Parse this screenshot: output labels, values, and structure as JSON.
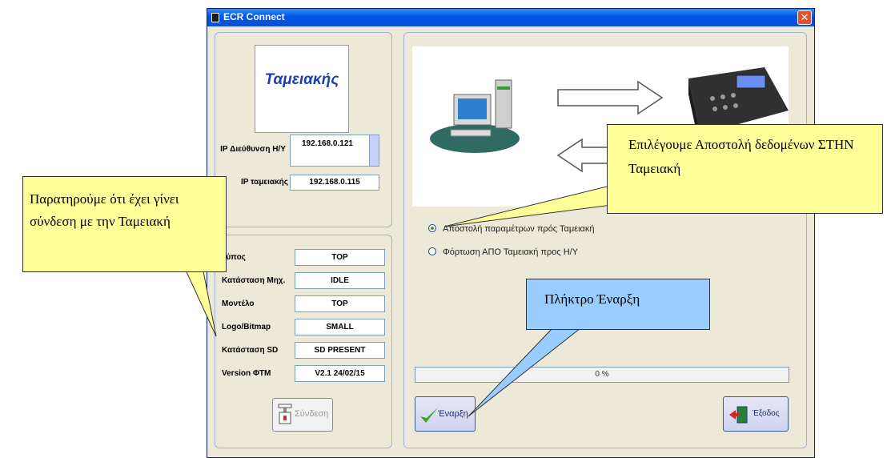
{
  "window": {
    "title": "ECR Connect",
    "close_glyph": "✕"
  },
  "left": {
    "logo_text": "Ταμειακής",
    "ip_pc_label": "IP Διεύθυνση Η/Υ",
    "ip_pc_value": "192.168.0.121",
    "ip_cash_label": "IP ταμειακής",
    "ip_cash_value": "192.168.0.115",
    "info_rows": [
      {
        "label": "Τύπος",
        "value": "TOP"
      },
      {
        "label": "Κατάσταση Μηχ.",
        "value": "IDLE"
      },
      {
        "label": "Μοντέλο",
        "value": "TOP"
      },
      {
        "label": "Logo/Bitmap",
        "value": "SMALL"
      },
      {
        "label": "Κατάσταση SD",
        "value": "SD PRESENT"
      },
      {
        "label": "Version ΦΤΜ",
        "value": "V2.1  24/02/15"
      }
    ],
    "connect_button": "Σύνδεση"
  },
  "right": {
    "radio_send": "Αποστολή  παραμέτρων πρός Ταμειακή",
    "radio_load": "Φόρτωση ΑΠΟ Ταμειακή προς Η/Υ",
    "progress_value": 0,
    "progress_text": "0 %",
    "start_button": "Έναρξη",
    "exit_button": "Έξοδος"
  },
  "callouts": {
    "connected": "Παρατηρούμε ότι έχει γίνει σύνδεση με την Ταμειακή",
    "send_choice": "Επιλέγουμε Αποστολή δεδομένων ΣΤΗΝ Ταμειακή",
    "start_key": "Πλήκτρο Έναρξη"
  },
  "colors": {
    "title_bar": "#0055e5",
    "callout_yellow": "#ffff99",
    "callout_blue": "#99ccff",
    "logo_text": "#1a3fae"
  },
  "icons": [
    "pc-icon",
    "cash-register-icon",
    "arrow-right-icon",
    "arrow-left-icon",
    "checkmark-icon",
    "exit-door-icon",
    "connect-plug-icon"
  ]
}
